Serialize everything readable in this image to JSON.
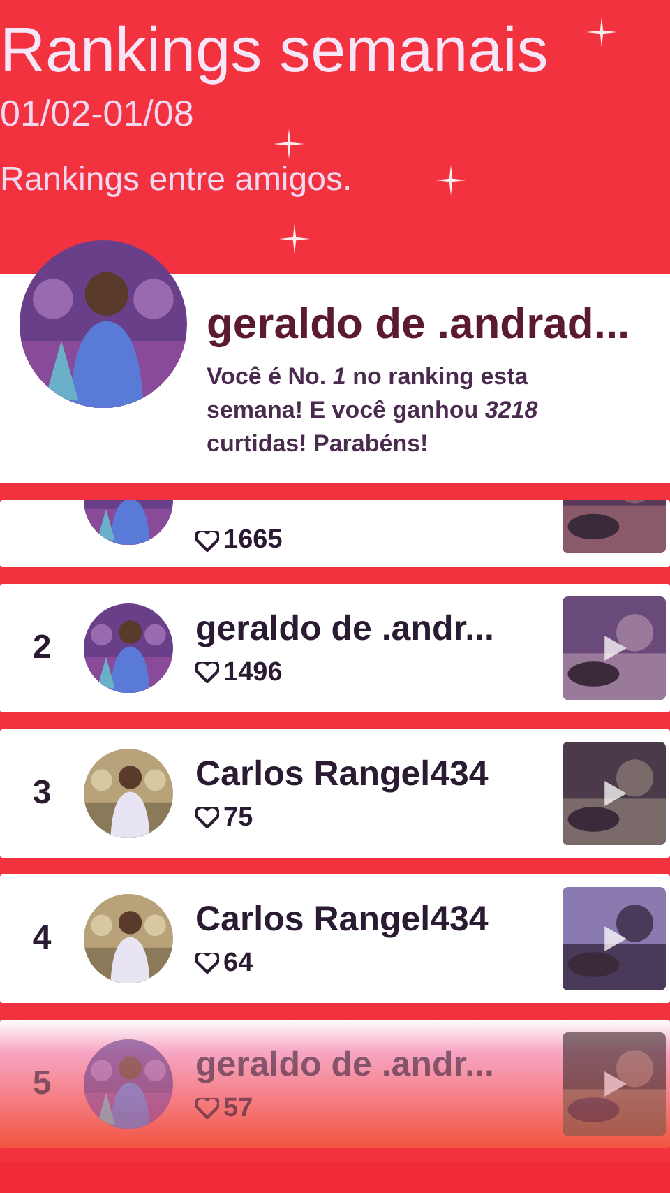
{
  "header": {
    "title": "Rankings semanais",
    "date_range": "01/02-01/08",
    "subtitle": "Rankings entre amigos."
  },
  "my_rank_card": {
    "name": "geraldo de .andrad...",
    "message": "Você é No. *1* no ranking esta semana! E você ganhou *3218* curtidas! Parabéns!"
  },
  "rankings": [
    {
      "kind": "partial",
      "likes": "1665"
    },
    {
      "kind": "full",
      "rank": "2",
      "name": "geraldo de .andr...",
      "likes": "1496"
    },
    {
      "kind": "full",
      "rank": "3",
      "name": "Carlos Rangel434",
      "likes": "75"
    },
    {
      "kind": "full",
      "rank": "4",
      "name": "Carlos Rangel434",
      "likes": "64"
    },
    {
      "kind": "faded",
      "rank": "5",
      "name": "geraldo de .andr...",
      "likes": "57"
    }
  ]
}
